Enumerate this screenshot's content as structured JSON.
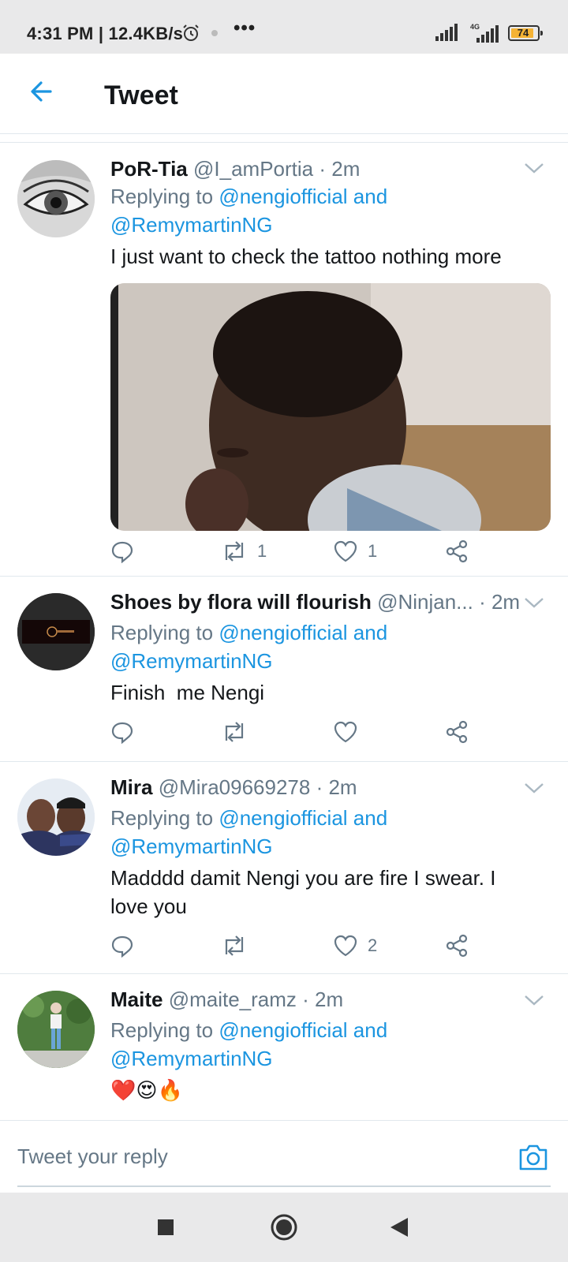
{
  "status_bar": {
    "time": "4:31 PM | 12.4KB/s",
    "more": "•••",
    "network": "4G",
    "battery": "74"
  },
  "header": {
    "title": "Tweet"
  },
  "tweets": [
    {
      "name": "PoR-Tia",
      "handle": "@I_amPortia",
      "time": "· 2m",
      "replying_prefix": "Replying to",
      "mention1": "@nengiofficial",
      "and": "and",
      "mention2": "@RemymartinNG",
      "text": "I just want to check the tattoo nothing more",
      "retweets": "1",
      "likes": "1"
    },
    {
      "name": "Shoes by flora will flourish",
      "handle": "@Ninjan...",
      "time": "· 2m",
      "replying_prefix": "Replying to",
      "mention1": "@nengiofficial",
      "and": "and",
      "mention2": "@RemymartinNG",
      "text": "Finish  me Nengi",
      "retweets": "",
      "likes": ""
    },
    {
      "name": "Mira",
      "handle": "@Mira09669278",
      "time": "· 2m",
      "replying_prefix": "Replying to",
      "mention1": "@nengiofficial",
      "and": "and",
      "mention2": "@RemymartinNG",
      "text1": "Madddd damit Nengi you are fire I swear. I",
      "text2": "love you",
      "retweets": "",
      "likes": "2"
    },
    {
      "name": "Maite",
      "handle": "@maite_ramz",
      "time": "· 2m",
      "replying_prefix": "Replying to",
      "mention1": "@nengiofficial",
      "and": "and",
      "mention2": "@RemymartinNG",
      "text": "❤️😍🔥"
    }
  ],
  "composer": {
    "placeholder": "Tweet your reply"
  },
  "colors": {
    "accent": "#1b95e0",
    "secondary_text": "#657786",
    "divider": "#e1e8ed"
  }
}
